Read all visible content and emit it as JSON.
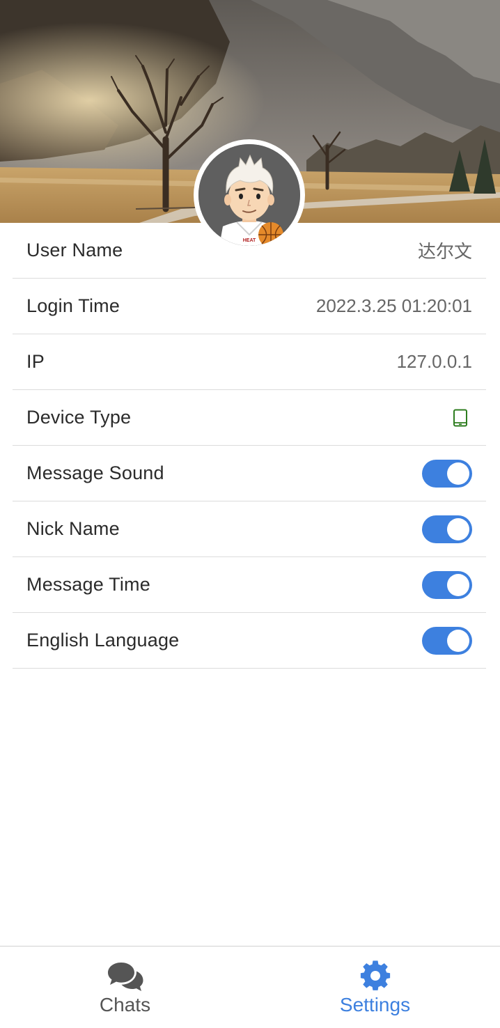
{
  "profile": {
    "avatar_icon": "avatar-basketball-player"
  },
  "settings": {
    "user_name": {
      "label": "User Name",
      "value": "达尔文"
    },
    "login_time": {
      "label": "Login Time",
      "value": "2022.3.25 01:20:01"
    },
    "ip": {
      "label": "IP",
      "value": "127.0.0.1"
    },
    "device_type": {
      "label": "Device Type",
      "icon": "tablet-icon",
      "icon_color": "#2e7d1f"
    },
    "message_sound": {
      "label": "Message Sound",
      "enabled": true
    },
    "nick_name": {
      "label": "Nick Name",
      "enabled": true
    },
    "message_time": {
      "label": "Message Time",
      "enabled": true
    },
    "english_language": {
      "label": "English Language",
      "enabled": true
    }
  },
  "tabbar": {
    "chats": {
      "label": "Chats",
      "icon": "chat-bubbles-icon"
    },
    "settings": {
      "label": "Settings",
      "icon": "gear-icon",
      "active": true
    }
  },
  "colors": {
    "accent": "#3d80df",
    "text": "#2b2b2b",
    "value_text": "#666666",
    "divider": "#dcdcdc",
    "inactive_tab": "#555555"
  }
}
